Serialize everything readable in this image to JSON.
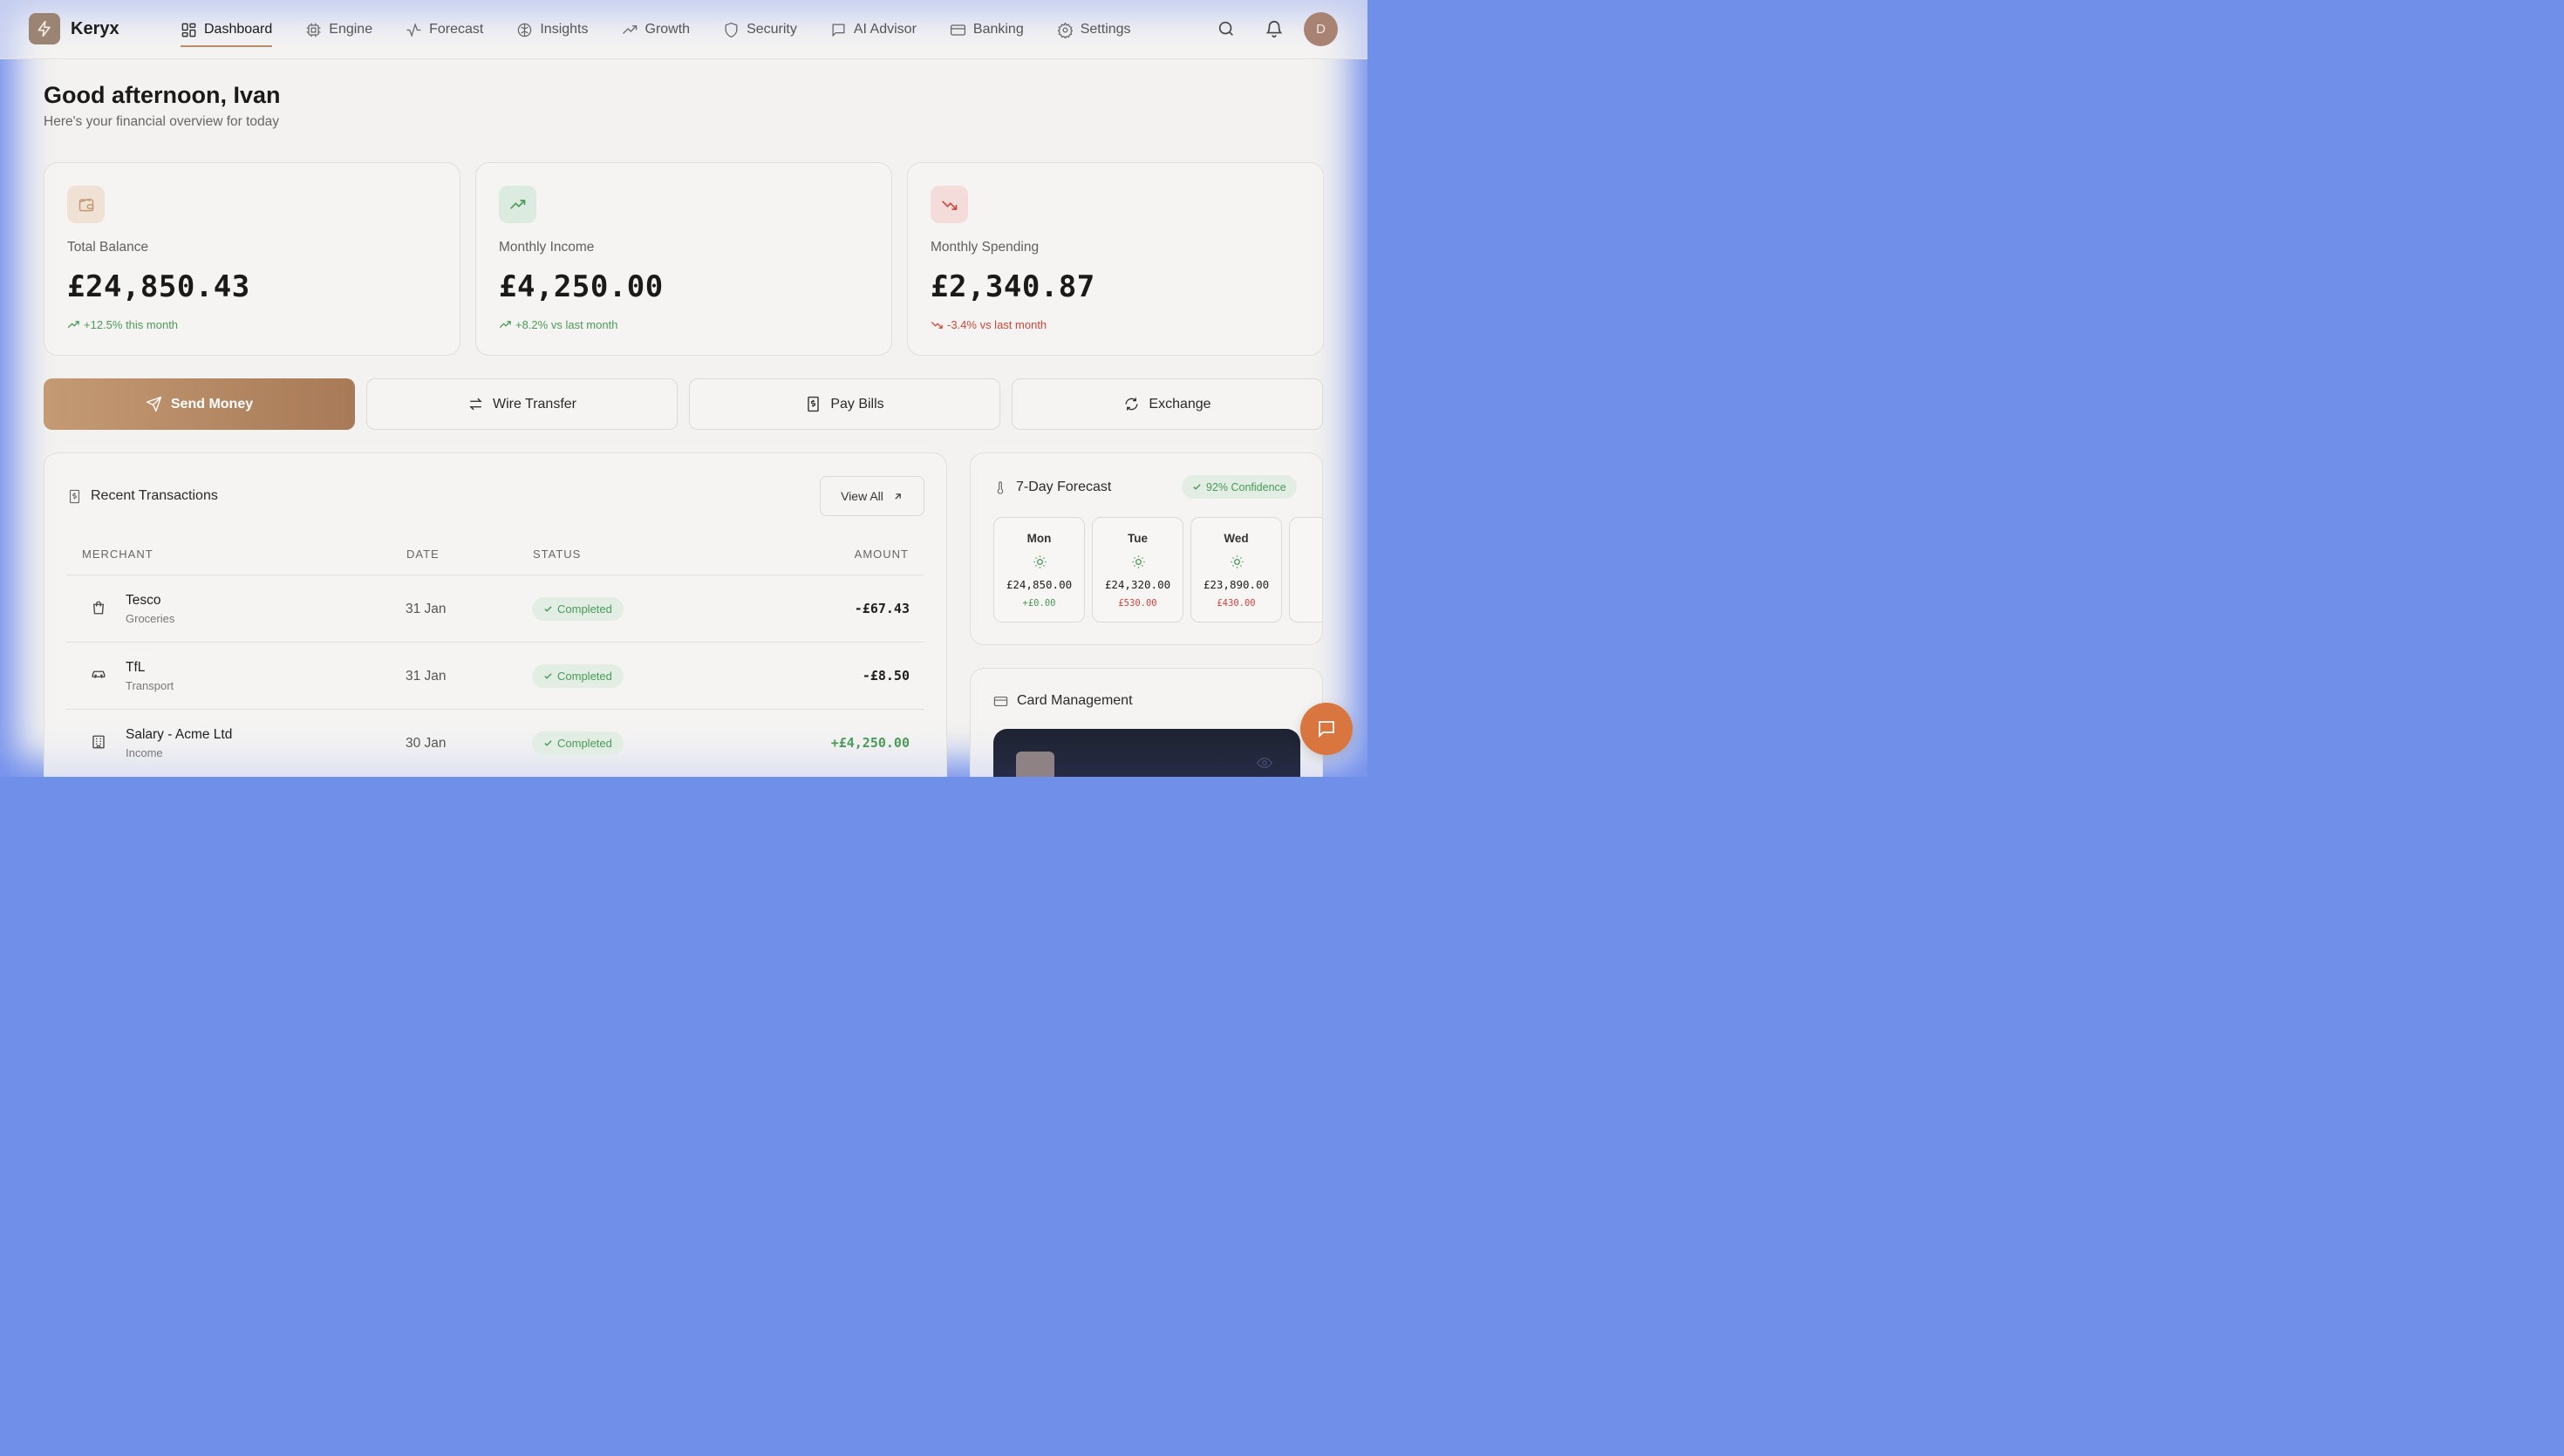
{
  "app": {
    "name": "Keryx"
  },
  "nav": {
    "items": [
      {
        "label": "Dashboard",
        "icon": "grid-icon",
        "active": true
      },
      {
        "label": "Engine",
        "icon": "chip-icon"
      },
      {
        "label": "Forecast",
        "icon": "activity-icon"
      },
      {
        "label": "Insights",
        "icon": "brain-icon"
      },
      {
        "label": "Growth",
        "icon": "trending-up-icon"
      },
      {
        "label": "Security",
        "icon": "shield-icon"
      },
      {
        "label": "AI Advisor",
        "icon": "chat-icon"
      },
      {
        "label": "Banking",
        "icon": "credit-card-icon"
      },
      {
        "label": "Settings",
        "icon": "gear-icon"
      }
    ]
  },
  "user": {
    "initial": "D"
  },
  "header": {
    "greeting": "Good afternoon, Ivan",
    "subtitle": "Here's your financial overview for today"
  },
  "stats": [
    {
      "label": "Total Balance",
      "value": "£24,850.43",
      "change": "+12.5% this month",
      "trend": "up",
      "icon": "wallet-icon"
    },
    {
      "label": "Monthly Income",
      "value": "£4,250.00",
      "change": "+8.2% vs last month",
      "trend": "up",
      "icon": "trending-up-icon"
    },
    {
      "label": "Monthly Spending",
      "value": "£2,340.87",
      "change": "-3.4% vs last month",
      "trend": "down",
      "icon": "trending-down-icon"
    }
  ],
  "actions": [
    {
      "label": "Send Money",
      "icon": "send-icon"
    },
    {
      "label": "Wire Transfer",
      "icon": "transfer-icon"
    },
    {
      "label": "Pay Bills",
      "icon": "bill-icon"
    },
    {
      "label": "Exchange",
      "icon": "refresh-icon"
    }
  ],
  "transactions": {
    "title": "Recent Transactions",
    "view_all": "View All",
    "columns": [
      "MERCHANT",
      "DATE",
      "STATUS",
      "AMOUNT"
    ],
    "rows": [
      {
        "merchant": "Tesco",
        "category": "Groceries",
        "date": "31 Jan",
        "status": "Completed",
        "amount": "-£67.43",
        "icon": "shopping-bag-icon"
      },
      {
        "merchant": "TfL",
        "category": "Transport",
        "date": "31 Jan",
        "status": "Completed",
        "amount": "-£8.50",
        "icon": "car-icon"
      },
      {
        "merchant": "Salary - Acme Ltd",
        "category": "Income",
        "date": "30 Jan",
        "status": "Completed",
        "amount": "+£4,250.00",
        "icon": "building-icon"
      }
    ]
  },
  "forecast": {
    "title": "7-Day Forecast",
    "confidence": "92% Confidence",
    "days": [
      {
        "day": "Mon",
        "value": "£24,850.00",
        "delta": "+£0.00",
        "trend": "up"
      },
      {
        "day": "Tue",
        "value": "£24,320.00",
        "delta": "£530.00",
        "trend": "down"
      },
      {
        "day": "Wed",
        "value": "£23,890.00",
        "delta": "£430.00",
        "trend": "down"
      }
    ]
  },
  "cards": {
    "title": "Card Management"
  },
  "colors": {
    "accent": "#b98e6a",
    "positive": "#4a9a58",
    "negative": "#d0463c",
    "fab": "#d9753e"
  }
}
